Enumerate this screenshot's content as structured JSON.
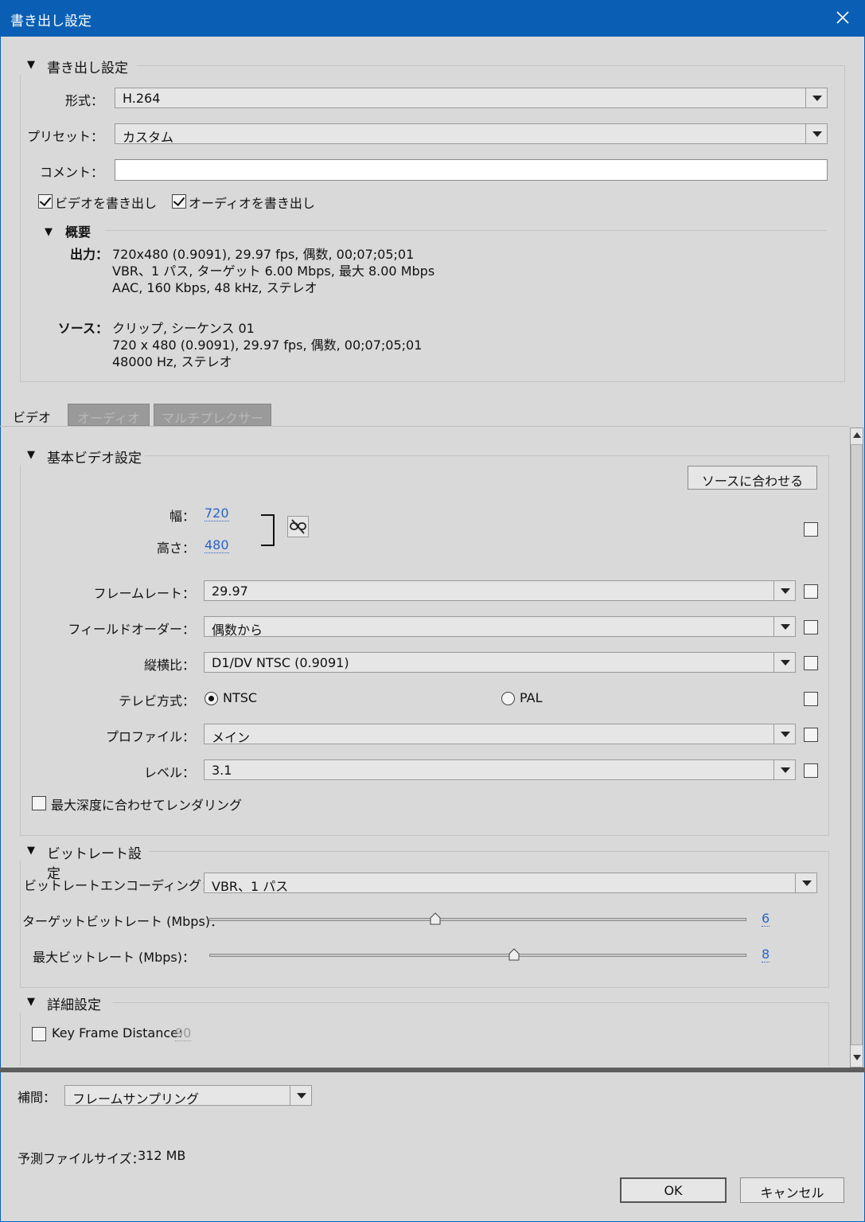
{
  "window": {
    "title": "書き出し設定"
  },
  "export": {
    "header": "書き出し設定",
    "format_label": "形式：",
    "format_value": "H.264",
    "preset_label": "プリセット：",
    "preset_value": "カスタム",
    "comment_label": "コメント：",
    "comment_value": "",
    "export_video_label": "ビデオを書き出し",
    "export_video_checked": true,
    "export_audio_label": "オーディオを書き出し",
    "export_audio_checked": true
  },
  "summary": {
    "header": "概要",
    "output_label": "出力：",
    "output_lines": [
      "720x480 (0.9091), 29.97 fps, 偶数, 00;07;05;01",
      "VBR、1 パス, ターゲット 6.00 Mbps, 最大 8.00 Mbps",
      "AAC, 160 Kbps, 48 kHz, ステレオ"
    ],
    "source_label": "ソース：",
    "source_lines": [
      "クリップ, シーケンス 01",
      "720 x 480 (0.9091), 29.97 fps, 偶数, 00;07;05;01",
      "48000 Hz, ステレオ"
    ]
  },
  "tabs": [
    {
      "label": "ビデオ",
      "active": true
    },
    {
      "label": "オーディオ",
      "active": false
    },
    {
      "label": "マルチプレクサー",
      "active": false
    }
  ],
  "basic_video": {
    "header": "基本ビデオ設定",
    "match_source_label": "ソースに合わせる",
    "width_label": "幅：",
    "width_value": "720",
    "height_label": "高さ：",
    "height_value": "480",
    "frame_rate_label": "フレームレート：",
    "frame_rate_value": "29.97",
    "field_order_label": "フィールドオーダー：",
    "field_order_value": "偶数から",
    "aspect_label": "縦横比：",
    "aspect_value": "D1/DV NTSC (0.9091)",
    "tv_standard_label": "テレビ方式：",
    "tv_ntsc_label": "NTSC",
    "tv_pal_label": "PAL",
    "tv_selected": "NTSC",
    "profile_label": "プロファイル：",
    "profile_value": "メイン",
    "level_label": "レベル：",
    "level_value": "3.1",
    "max_depth_label": "最大深度に合わせてレンダリング"
  },
  "bitrate": {
    "header": "ビットレート設定",
    "encoding_label": "ビットレートエンコーディング：",
    "encoding_value": "VBR、1 パス",
    "target_label": "ターゲットビットレート (Mbps)：",
    "target_value": "6",
    "target_fraction": 0.42,
    "max_label": "最大ビットレート (Mbps)：",
    "max_value": "8",
    "max_fraction": 0.567
  },
  "advanced": {
    "header": "詳細設定",
    "keyframe_label": "Key Frame Distance:",
    "keyframe_value": "90"
  },
  "footer": {
    "interp_label": "補間：",
    "interp_value": "フレームサンプリング",
    "filesize_label": "予測ファイルサイズ：",
    "filesize_value": "312 MB",
    "ok_label": "OK",
    "cancel_label": "キャンセル"
  }
}
